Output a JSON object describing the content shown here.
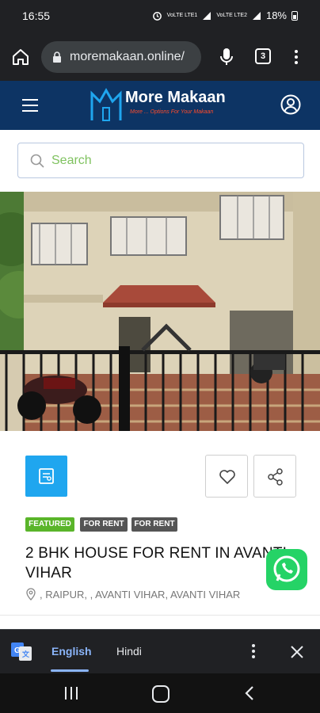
{
  "status_bar": {
    "time": "16:55",
    "network_1": "VoLTE LTE1",
    "network_2": "VoLTE LTE2",
    "battery": "18%"
  },
  "browser": {
    "url": "moremakaan.online/",
    "tab_count": "3",
    "icons": [
      "home-icon",
      "lock-icon",
      "mic-icon",
      "tabs-icon",
      "more-vert-icon"
    ]
  },
  "site_header": {
    "logo_title": "More Makaan",
    "logo_tagline": "More ... Options For Your Makaan",
    "icons": [
      "hamburger-icon",
      "user-account-icon"
    ]
  },
  "search": {
    "placeholder": "Search"
  },
  "listing": {
    "badges": [
      "FEATURED",
      "FOR RENT",
      "FOR RENT"
    ],
    "title": "2 BHK HOUSE FOR RENT IN AVANTI VIHAR",
    "location": ", RAIPUR, , AVANTI VIHAR, AVANTI VIHAR",
    "icons": [
      "listing-type-icon",
      "heart-icon",
      "share-icon",
      "location-pin-icon",
      "whatsapp-icon"
    ]
  },
  "translate_bar": {
    "languages": [
      "English",
      "Hindi"
    ],
    "selected": "English",
    "icons": [
      "google-translate-icon",
      "more-vert-icon",
      "close-icon"
    ]
  },
  "nav_bar": {
    "icons": [
      "recent-apps-icon",
      "home-button-icon",
      "back-icon"
    ]
  },
  "colors": {
    "header_bg": "#0d3464",
    "accent_blue": "#1fa6ef",
    "featured_green": "#5ab52a",
    "whatsapp_green": "#25d366",
    "placeholder_green": "#7fc25f"
  }
}
